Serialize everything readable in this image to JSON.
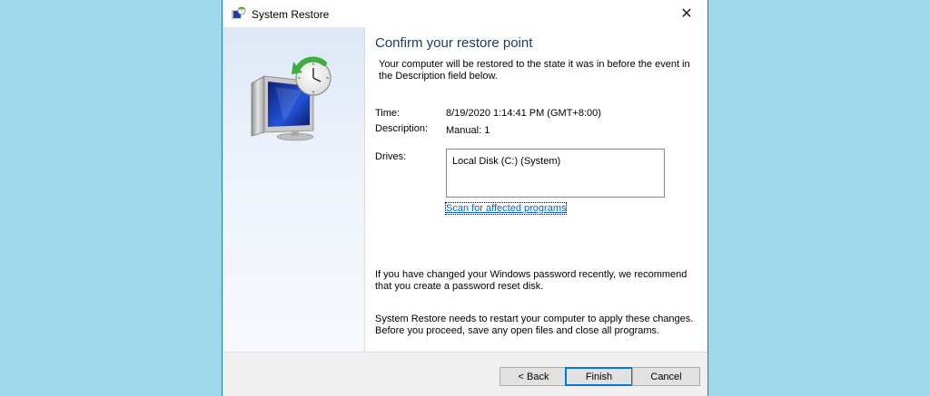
{
  "window": {
    "title": "System Restore",
    "app_icon": "system-restore-icon",
    "close_glyph": "✕"
  },
  "main": {
    "heading": "Confirm your restore point",
    "intro": "Your computer will be restored to the state it was in before the event in the Description field below.",
    "time_label": "Time:",
    "time_value": "8/19/2020 1:14:41 PM (GMT+8:00)",
    "description_label": "Description:",
    "description_value": "Manual: 1",
    "drives_label": "Drives:",
    "drives": [
      "Local Disk (C:) (System)"
    ],
    "scan_link": "Scan for affected programs",
    "password_note": "If you have changed your Windows password recently, we recommend that you create a password reset disk.",
    "restart_note": "System Restore needs to restart your computer to apply these changes. Before you proceed, save any open files and close all programs."
  },
  "buttons": {
    "back": "< Back",
    "finish": "Finish",
    "cancel": "Cancel"
  },
  "colors": {
    "accent": "#0078d7",
    "heading": "#1e395b",
    "link": "#0066cc",
    "desktop": "#9fd9e9"
  }
}
